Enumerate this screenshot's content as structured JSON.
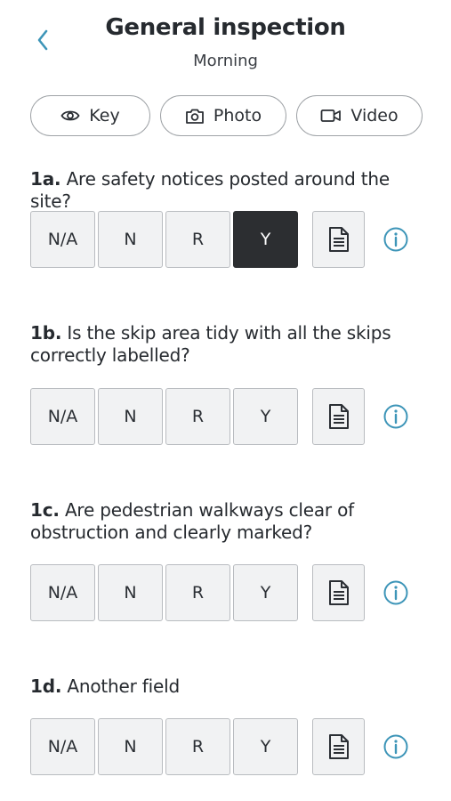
{
  "header": {
    "title": "General inspection",
    "subtitle": "Morning"
  },
  "media": {
    "key_label": "Key",
    "photo_label": "Photo",
    "video_label": "Video"
  },
  "options": {
    "na": "N/A",
    "n": "N",
    "r": "R",
    "y": "Y"
  },
  "questions": [
    {
      "number": "1a.",
      "text": " Are safety notices posted around the site?",
      "selected": "Y"
    },
    {
      "number": "1b.",
      "text": " Is the skip area tidy with all the skips correctly labelled?",
      "selected": null
    },
    {
      "number": "1c.",
      "text": " Are pedestrian walkways clear of obstruction and clearly marked?",
      "selected": null
    },
    {
      "number": "1d.",
      "text": " Another field",
      "selected": null
    }
  ],
  "icons": {
    "back": "chevron-left-icon",
    "key": "eye-icon",
    "photo": "camera-icon",
    "video": "video-camera-icon",
    "note": "document-icon",
    "info": "info-icon"
  },
  "colors": {
    "accent": "#3d95b8",
    "selected_bg": "#2c2e31",
    "option_bg": "#f1f2f3",
    "text": "#262a2f"
  }
}
